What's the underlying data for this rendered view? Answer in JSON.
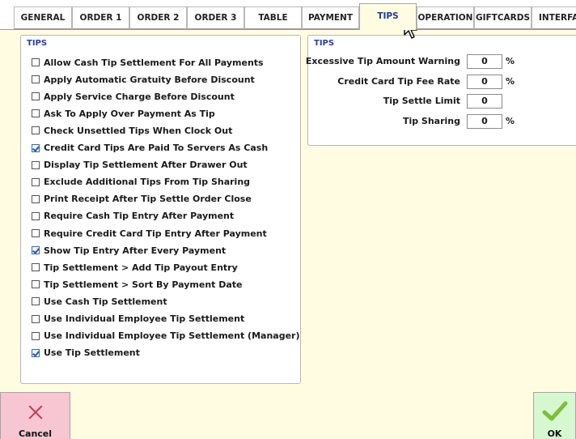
{
  "tabs": [
    "GENERAL",
    "ORDER 1",
    "ORDER 2",
    "ORDER 3",
    "TABLE",
    "PAYMENT",
    "TIPS",
    "OPERATION",
    "GIFTCARDS",
    "INTERFAC"
  ],
  "active_tab": "TIPS",
  "left_panel": {
    "title": "TIPS",
    "options": [
      {
        "label": "Allow Cash Tip Settlement For All Payments",
        "checked": false
      },
      {
        "label": "Apply Automatic Gratuity Before Discount",
        "checked": false
      },
      {
        "label": "Apply Service Charge Before Discount",
        "checked": false
      },
      {
        "label": "Ask To Apply Over Payment As Tip",
        "checked": false
      },
      {
        "label": "Check Unsettled Tips When Clock Out",
        "checked": false
      },
      {
        "label": "Credit Card Tips Are Paid To Servers As Cash",
        "checked": true
      },
      {
        "label": "Display Tip Settlement After Drawer Out",
        "checked": false
      },
      {
        "label": "Exclude Additional Tips From Tip Sharing",
        "checked": false
      },
      {
        "label": "Print Receipt After Tip Settle Order Close",
        "checked": false
      },
      {
        "label": "Require Cash Tip Entry After Payment",
        "checked": false
      },
      {
        "label": "Require Credit Card Tip Entry After Payment",
        "checked": false
      },
      {
        "label": "Show Tip Entry After Every Payment",
        "checked": true
      },
      {
        "label": "Tip Settlement > Add Tip Payout Entry",
        "checked": false
      },
      {
        "label": "Tip Settlement > Sort By Payment Date",
        "checked": false
      },
      {
        "label": "Use Cash Tip Settlement",
        "checked": false
      },
      {
        "label": "Use Individual Employee Tip Settlement",
        "checked": false
      },
      {
        "label": "Use Individual Employee Tip Settlement (Manager)",
        "checked": false
      },
      {
        "label": "Use Tip Settlement",
        "checked": true
      }
    ]
  },
  "right_panel": {
    "title": "TIPS",
    "fields": [
      {
        "label": "Excessive Tip Amount Warning",
        "value": "0",
        "unit": "%"
      },
      {
        "label": "Credit Card Tip Fee Rate",
        "value": "0",
        "unit": "%"
      },
      {
        "label": "Tip Settle Limit",
        "value": "0",
        "unit": ""
      },
      {
        "label": "Tip Sharing",
        "value": "0",
        "unit": "%"
      }
    ]
  },
  "buttons": {
    "cancel": "Cancel",
    "ok": "OK"
  },
  "colors": {
    "background": "#fffce2",
    "active_tab_text": "#1f3b99",
    "cancel_bg": "#f6c6d2",
    "ok_bg": "#d6f7d0"
  }
}
